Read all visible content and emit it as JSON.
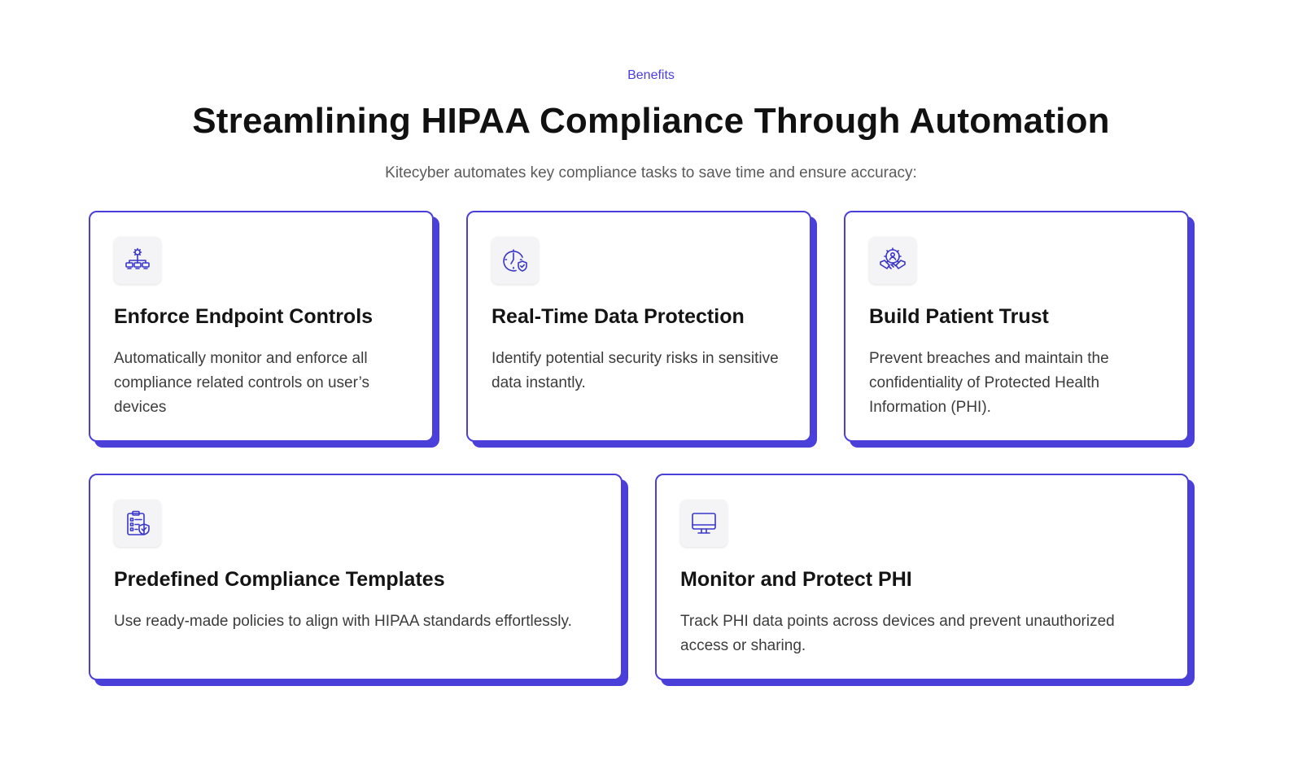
{
  "header": {
    "eyebrow": "Benefits",
    "title": "Streamlining HIPAA Compliance Through Automation",
    "subtitle": "Kitecyber automates key compliance tasks to save time and ensure accuracy:"
  },
  "cards": [
    {
      "icon": "endpoint-controls-icon",
      "title": "Enforce Endpoint Controls",
      "description": "Automatically monitor and enforce all compliance related controls on user’s devices"
    },
    {
      "icon": "clock-shield-icon",
      "title": "Real-Time Data Protection",
      "description": "Identify potential security risks in sensitive data instantly."
    },
    {
      "icon": "handshake-gear-icon",
      "title": "Build Patient Trust",
      "description": "Prevent breaches and maintain the confidentiality of Protected Health Information (PHI)."
    },
    {
      "icon": "clipboard-shield-icon",
      "title": "Predefined Compliance Templates",
      "description": "Use ready-made policies to align with HIPAA standards effortlessly."
    },
    {
      "icon": "monitor-icon",
      "title": "Monitor and Protect PHI",
      "description": "Track PHI data points across devices and prevent unauthorized access or sharing."
    }
  ],
  "colors": {
    "accent": "#4a3fd9",
    "icon_stroke": "#3a36c8"
  }
}
